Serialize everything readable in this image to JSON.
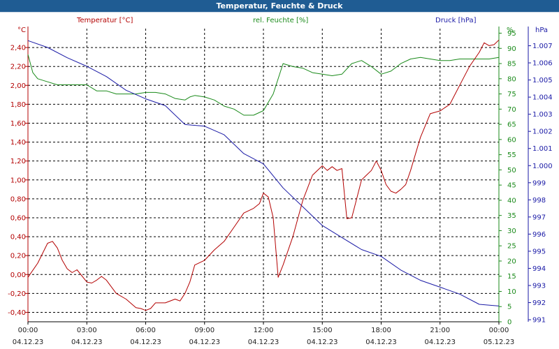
{
  "title": "Temperatur, Feuchte & Druck",
  "chart_data": {
    "type": "line",
    "x_start": "04.12.23 00:00",
    "x_end": "05.12.23 00:00",
    "x_tick_times": [
      "00:00",
      "03:00",
      "06:00",
      "09:00",
      "12:00",
      "15:00",
      "18:00",
      "21:00",
      "00:00"
    ],
    "x_tick_dates": [
      "04.12.23",
      "04.12.23",
      "04.12.23",
      "04.12.23",
      "04.12.23",
      "04.12.23",
      "04.12.23",
      "04.12.23",
      "05.12.23"
    ],
    "grid": true,
    "axes": {
      "temperature": {
        "label": "Temperatur [°C]",
        "unit": "°C",
        "ylim": [
          -0.5,
          2.6
        ],
        "color": "#b30000",
        "ticks": [
          "-0,40",
          "-0,20",
          "0,00",
          "0,20",
          "0,40",
          "0,60",
          "0,80",
          "1,00",
          "1,20",
          "1,40",
          "1,60",
          "1,80",
          "2,00",
          "2,20",
          "2,40"
        ]
      },
      "humidity": {
        "label": "rel. Feuchte [%]",
        "unit": "%",
        "ylim": [
          0,
          96.5
        ],
        "color": "#1a8a1a",
        "ticks": [
          "0",
          "5",
          "10",
          "15",
          "20",
          "25",
          "30",
          "35",
          "40",
          "45",
          "50",
          "55",
          "60",
          "65",
          "70",
          "75",
          "80",
          "85",
          "90",
          "95"
        ]
      },
      "pressure": {
        "label": "Druck [hPa]",
        "unit": "hPa",
        "ylim": [
          990.88,
          1008.0
        ],
        "color": "#1a1aa6",
        "ticks": [
          "991",
          "992",
          "993",
          "994",
          "995",
          "996",
          "997",
          "998",
          "999",
          "1.000",
          "1.001",
          "1.002",
          "1.003",
          "1.004",
          "1.005",
          "1.006",
          "1.007"
        ]
      }
    },
    "series": [
      {
        "name": "Temperatur [°C]",
        "axis": "temperature",
        "color": "#b30000",
        "x_hours": [
          0,
          0.5,
          1,
          1.25,
          1.5,
          1.75,
          2,
          2.25,
          2.5,
          3,
          3.25,
          3.5,
          3.75,
          4,
          4.5,
          5,
          5.5,
          5.75,
          6,
          6.25,
          6.5,
          7,
          7.5,
          7.75,
          8,
          8.25,
          8.5,
          9,
          9.5,
          10,
          10.5,
          11,
          11.5,
          11.8,
          12,
          12.25,
          12.5,
          12.75,
          13,
          13.5,
          14,
          14.5,
          15,
          15.25,
          15.5,
          15.75,
          16,
          16.25,
          16.5,
          17,
          17.25,
          17.5,
          17.75,
          18,
          18.25,
          18.5,
          18.75,
          19,
          19.25,
          19.5,
          20,
          20.5,
          21,
          21.5,
          22,
          22.5,
          23,
          23.25,
          23.5,
          23.75,
          24
        ],
        "y": [
          -0.03,
          0.12,
          0.33,
          0.35,
          0.28,
          0.15,
          0.06,
          0.02,
          0.05,
          -0.08,
          -0.09,
          -0.06,
          -0.02,
          -0.06,
          -0.2,
          -0.26,
          -0.35,
          -0.36,
          -0.38,
          -0.36,
          -0.3,
          -0.3,
          -0.26,
          -0.28,
          -0.2,
          -0.08,
          0.1,
          0.15,
          0.26,
          0.35,
          0.5,
          0.65,
          0.7,
          0.75,
          0.86,
          0.82,
          0.6,
          -0.03,
          0.1,
          0.4,
          0.78,
          1.05,
          1.15,
          1.1,
          1.14,
          1.1,
          1.12,
          0.59,
          0.6,
          1.0,
          1.05,
          1.1,
          1.2,
          1.1,
          0.95,
          0.88,
          0.86,
          0.9,
          0.95,
          1.1,
          1.45,
          1.7,
          1.73,
          1.8,
          2.0,
          2.2,
          2.35,
          2.45,
          2.42,
          2.43,
          2.48
        ]
      },
      {
        "name": "rel. Feuchte [%]",
        "axis": "humidity",
        "color": "#1a8a1a",
        "x_hours": [
          0,
          0.25,
          0.5,
          1,
          1.5,
          2,
          2.5,
          3,
          3.5,
          4,
          4.5,
          5,
          5.5,
          6,
          6.5,
          7,
          7.5,
          8,
          8.25,
          8.5,
          9,
          9.5,
          10,
          10.5,
          11,
          11.5,
          12,
          12.5,
          13,
          13.5,
          14,
          14.5,
          15,
          15.5,
          16,
          16.5,
          17,
          17.5,
          18,
          18.5,
          19,
          19.5,
          20,
          20.5,
          21,
          21.5,
          22,
          22.5,
          23,
          23.5,
          24
        ],
        "y": [
          88,
          82,
          80,
          79,
          78,
          78,
          78,
          78,
          76,
          76,
          75,
          75,
          75,
          75.5,
          75.5,
          75,
          73.5,
          73,
          74,
          74.5,
          74,
          73,
          71,
          70,
          68,
          68,
          69.5,
          75,
          85,
          84,
          83.5,
          82,
          81.5,
          81,
          81.5,
          85,
          86,
          84,
          81.5,
          82.5,
          85,
          86.5,
          87,
          86.5,
          86,
          86,
          86.5,
          86.5,
          86.5,
          86.5,
          87
        ]
      },
      {
        "name": "Druck [hPa]",
        "axis": "pressure",
        "color": "#1a1aa6",
        "x_hours": [
          0,
          1,
          2,
          3,
          4,
          5,
          6,
          7,
          8,
          9,
          10,
          11,
          12,
          13,
          14,
          15,
          16,
          17,
          18,
          19,
          20,
          21,
          22,
          23,
          24
        ],
        "y": [
          1007.3,
          1006.9,
          1006.3,
          1005.8,
          1005.2,
          1004.4,
          1003.9,
          1003.5,
          1002.4,
          1002.3,
          1001.8,
          1000.7,
          1000.1,
          998.7,
          997.6,
          996.5,
          995.8,
          995.1,
          994.7,
          993.9,
          993.3,
          992.9,
          992.5,
          991.9,
          991.8
        ]
      }
    ]
  }
}
